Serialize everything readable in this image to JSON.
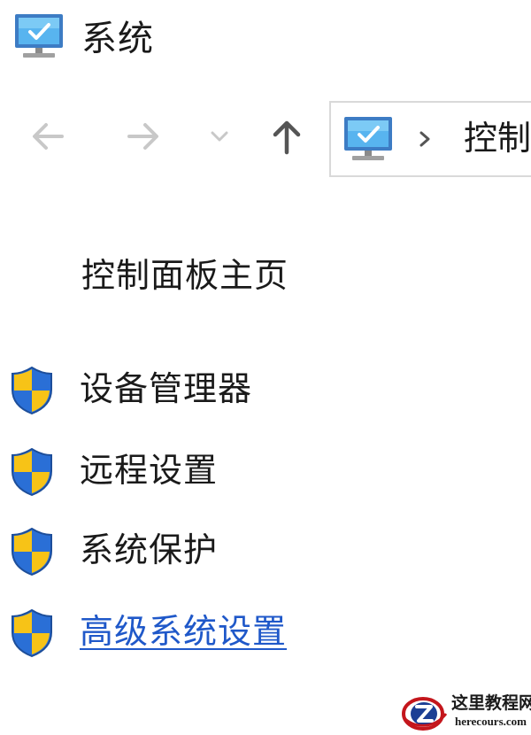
{
  "window": {
    "title": "系统",
    "icon": "computer-monitor-icon"
  },
  "navigation": {
    "back_icon": "arrow-left-icon",
    "forward_icon": "arrow-right-icon",
    "recent_icon": "chevron-down-icon",
    "up_icon": "arrow-up-icon",
    "address": {
      "icon": "computer-monitor-icon",
      "separator_icon": "chevron-right-icon",
      "path_text": "控制面板"
    }
  },
  "sidebar": {
    "home_link": "控制面板主页",
    "tasks": [
      {
        "label": "设备管理器",
        "icon": "uac-shield-icon",
        "active": false
      },
      {
        "label": "远程设置",
        "icon": "uac-shield-icon",
        "active": false
      },
      {
        "label": "系统保护",
        "icon": "uac-shield-icon",
        "active": false
      },
      {
        "label": "高级系统设置",
        "icon": "uac-shield-icon",
        "active": true
      }
    ]
  },
  "watermark": {
    "name": "这里教程网",
    "url": "herecours.com"
  },
  "colors": {
    "link_active": "#1f58c9",
    "text": "#1a1a1a",
    "nav_disabled": "#c8c8c8",
    "nav_enabled": "#555555",
    "shield_blue": "#2a6fd6",
    "shield_yellow": "#f7c317",
    "monitor_blue": "#3da0e8"
  }
}
